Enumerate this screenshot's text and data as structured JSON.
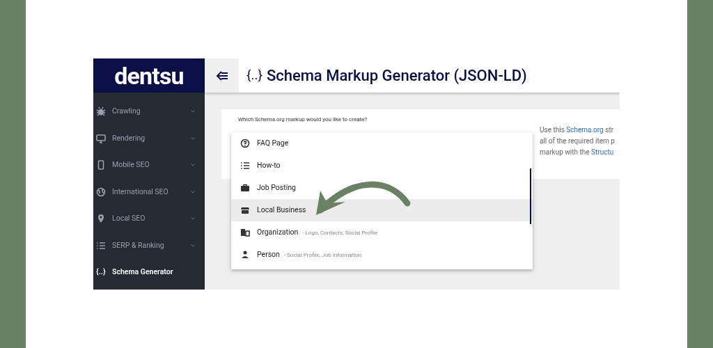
{
  "logo": "dentsu",
  "sidebar": {
    "items": [
      {
        "label": "Crawling",
        "expandable": true,
        "selected": false
      },
      {
        "label": "Rendering",
        "expandable": true,
        "selected": false
      },
      {
        "label": "Mobile SEO",
        "expandable": true,
        "selected": false
      },
      {
        "label": "International SEO",
        "expandable": true,
        "selected": false
      },
      {
        "label": "Local SEO",
        "expandable": true,
        "selected": false
      },
      {
        "label": "SERP & Ranking",
        "expandable": true,
        "selected": false
      },
      {
        "label": "Schema Generator",
        "icon_text": "{..}",
        "expandable": false,
        "selected": true
      }
    ]
  },
  "header": {
    "title_icon": "{..}",
    "title": "Schema Markup Generator (JSON-LD)"
  },
  "form": {
    "label": "Which Schema.org markup would you like to create?",
    "dropdown": {
      "options": [
        {
          "label": "FAQ Page",
          "selected": false
        },
        {
          "label": "How-to",
          "selected": false
        },
        {
          "label": "Job Posting",
          "selected": false
        },
        {
          "label": "Local Business",
          "selected": true
        },
        {
          "label": "Organization",
          "detail": "- Logo, Contacts, Social Profile",
          "selected": false
        },
        {
          "label": "Person",
          "detail": "- Social Profile, Job Information",
          "selected": false
        }
      ]
    }
  },
  "info": {
    "lines": [
      [
        {
          "kind": "text",
          "text": "Use this "
        },
        {
          "kind": "link",
          "text": "Schema.org"
        },
        {
          "kind": "text",
          "text": " str"
        }
      ],
      [
        {
          "kind": "text",
          "text": "all of the required item p"
        }
      ],
      [
        {
          "kind": "text",
          "text": "markup with the "
        },
        {
          "kind": "link",
          "text": "Structu"
        }
      ]
    ]
  }
}
